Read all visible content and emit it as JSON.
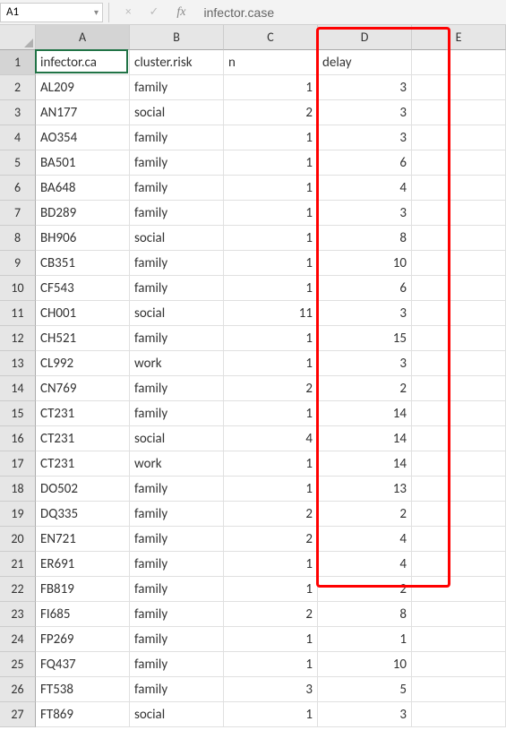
{
  "name_box": "A1",
  "formula_bar": "infector.case",
  "fx_label": "fx",
  "x_label": "×",
  "check_label": "✓",
  "columns": [
    "A",
    "B",
    "C",
    "D",
    "E"
  ],
  "headers": {
    "A": "infector.case",
    "B": "cluster.risk",
    "C": "n",
    "D": "delay",
    "E": ""
  },
  "rows": [
    {
      "r": 2,
      "A": "AL209",
      "B": "family",
      "C": "1",
      "D": "3",
      "E": ""
    },
    {
      "r": 3,
      "A": "AN177",
      "B": "social",
      "C": "2",
      "D": "3",
      "E": ""
    },
    {
      "r": 4,
      "A": "AO354",
      "B": "family",
      "C": "1",
      "D": "3",
      "E": ""
    },
    {
      "r": 5,
      "A": "BA501",
      "B": "family",
      "C": "1",
      "D": "6",
      "E": ""
    },
    {
      "r": 6,
      "A": "BA648",
      "B": "family",
      "C": "1",
      "D": "4",
      "E": ""
    },
    {
      "r": 7,
      "A": "BD289",
      "B": "family",
      "C": "1",
      "D": "3",
      "E": ""
    },
    {
      "r": 8,
      "A": "BH906",
      "B": "social",
      "C": "1",
      "D": "8",
      "E": ""
    },
    {
      "r": 9,
      "A": "CB351",
      "B": "family",
      "C": "1",
      "D": "10",
      "E": ""
    },
    {
      "r": 10,
      "A": "CF543",
      "B": "family",
      "C": "1",
      "D": "6",
      "E": ""
    },
    {
      "r": 11,
      "A": "CH001",
      "B": "social",
      "C": "11",
      "D": "3",
      "E": ""
    },
    {
      "r": 12,
      "A": "CH521",
      "B": "family",
      "C": "1",
      "D": "15",
      "E": ""
    },
    {
      "r": 13,
      "A": "CL992",
      "B": "work",
      "C": "1",
      "D": "3",
      "E": ""
    },
    {
      "r": 14,
      "A": "CN769",
      "B": "family",
      "C": "2",
      "D": "2",
      "E": ""
    },
    {
      "r": 15,
      "A": "CT231",
      "B": "family",
      "C": "1",
      "D": "14",
      "E": ""
    },
    {
      "r": 16,
      "A": "CT231",
      "B": "social",
      "C": "4",
      "D": "14",
      "E": ""
    },
    {
      "r": 17,
      "A": "CT231",
      "B": "work",
      "C": "1",
      "D": "14",
      "E": ""
    },
    {
      "r": 18,
      "A": "DO502",
      "B": "family",
      "C": "1",
      "D": "13",
      "E": ""
    },
    {
      "r": 19,
      "A": "DQ335",
      "B": "family",
      "C": "2",
      "D": "2",
      "E": ""
    },
    {
      "r": 20,
      "A": "EN721",
      "B": "family",
      "C": "2",
      "D": "4",
      "E": ""
    },
    {
      "r": 21,
      "A": "ER691",
      "B": "family",
      "C": "1",
      "D": "4",
      "E": ""
    },
    {
      "r": 22,
      "A": "FB819",
      "B": "family",
      "C": "1",
      "D": "2",
      "E": ""
    },
    {
      "r": 23,
      "A": "FI685",
      "B": "family",
      "C": "2",
      "D": "8",
      "E": ""
    },
    {
      "r": 24,
      "A": "FP269",
      "B": "family",
      "C": "1",
      "D": "1",
      "E": ""
    },
    {
      "r": 25,
      "A": "FQ437",
      "B": "family",
      "C": "1",
      "D": "10",
      "E": ""
    },
    {
      "r": 26,
      "A": "FT538",
      "B": "family",
      "C": "3",
      "D": "5",
      "E": ""
    },
    {
      "r": 27,
      "A": "FT869",
      "B": "social",
      "C": "1",
      "D": "3",
      "E": ""
    }
  ],
  "chart_data": {
    "type": "table",
    "columns": [
      "infector.case",
      "cluster.risk",
      "n",
      "delay"
    ],
    "data": [
      [
        "AL209",
        "family",
        1,
        3
      ],
      [
        "AN177",
        "social",
        2,
        3
      ],
      [
        "AO354",
        "family",
        1,
        3
      ],
      [
        "BA501",
        "family",
        1,
        6
      ],
      [
        "BA648",
        "family",
        1,
        4
      ],
      [
        "BD289",
        "family",
        1,
        3
      ],
      [
        "BH906",
        "social",
        1,
        8
      ],
      [
        "CB351",
        "family",
        1,
        10
      ],
      [
        "CF543",
        "family",
        1,
        6
      ],
      [
        "CH001",
        "social",
        11,
        3
      ],
      [
        "CH521",
        "family",
        1,
        15
      ],
      [
        "CL992",
        "work",
        1,
        3
      ],
      [
        "CN769",
        "family",
        2,
        2
      ],
      [
        "CT231",
        "family",
        1,
        14
      ],
      [
        "CT231",
        "social",
        4,
        14
      ],
      [
        "CT231",
        "work",
        1,
        14
      ],
      [
        "DO502",
        "family",
        1,
        13
      ],
      [
        "DQ335",
        "family",
        2,
        2
      ],
      [
        "EN721",
        "family",
        2,
        4
      ],
      [
        "ER691",
        "family",
        1,
        4
      ],
      [
        "FB819",
        "family",
        1,
        2
      ],
      [
        "FI685",
        "family",
        2,
        8
      ],
      [
        "FP269",
        "family",
        1,
        1
      ],
      [
        "FQ437",
        "family",
        1,
        10
      ],
      [
        "FT538",
        "family",
        3,
        5
      ],
      [
        "FT869",
        "social",
        1,
        3
      ]
    ]
  }
}
